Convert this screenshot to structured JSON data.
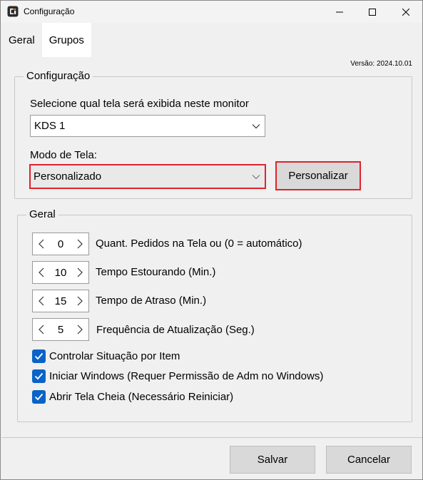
{
  "window": {
    "title": "Configuração",
    "accent": "#0a63c7",
    "highlight": "#e0222b"
  },
  "tabs": [
    {
      "label": "Geral",
      "active": false
    },
    {
      "label": "Grupos",
      "active": true
    }
  ],
  "version": "Versão: 2024.10.01",
  "config_group": {
    "legend": "Configuração",
    "monitor_label": "Selecione qual tela será exibida neste monitor",
    "monitor_value": "KDS 1",
    "mode_label": "Modo de Tela:",
    "mode_value": "Personalizado",
    "customize_button": "Personalizar"
  },
  "general_group": {
    "legend": "Geral",
    "steppers": [
      {
        "value": "0",
        "label": "Quant. Pedidos na Tela ou (0 = automático)"
      },
      {
        "value": "10",
        "label": "Tempo Estourando (Min.)"
      },
      {
        "value": "15",
        "label": "Tempo de Atraso (Min.)"
      },
      {
        "value": "5",
        "label": "Frequência de Atualização (Seg.)"
      }
    ],
    "checks": [
      {
        "label": "Controlar Situação por Item",
        "checked": true
      },
      {
        "label": "Iniciar Windows (Requer Permissão de Adm no Windows)",
        "checked": true
      },
      {
        "label": "Abrir Tela Cheia (Necessário Reiniciar)",
        "checked": true
      }
    ]
  },
  "footer": {
    "save_label": "Salvar",
    "cancel_label": "Cancelar"
  }
}
